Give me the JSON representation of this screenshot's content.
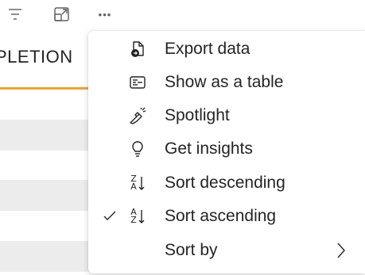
{
  "background": {
    "column_header": "PLETION",
    "accent_color": "#f2a22a"
  },
  "toolbar": {
    "filter_icon": "filter-icon",
    "focus_mode_icon": "focus-mode-icon",
    "more_options_label": "•••"
  },
  "menu": {
    "items": [
      {
        "label": "Export data",
        "icon": "export-data-icon",
        "checked": false
      },
      {
        "label": "Show as a table",
        "icon": "table-icon",
        "checked": false
      },
      {
        "label": "Spotlight",
        "icon": "spotlight-icon",
        "checked": false
      },
      {
        "label": "Get insights",
        "icon": "lightbulb-icon",
        "checked": false
      },
      {
        "label": "Sort descending",
        "icon": "sort-descending-icon",
        "checked": false
      },
      {
        "label": "Sort ascending",
        "icon": "sort-ascending-icon",
        "checked": true
      },
      {
        "label": "Sort by",
        "icon": "",
        "checked": false,
        "has_submenu": true
      }
    ],
    "sort_desc_glyph": {
      "top": "Z",
      "bottom": "A"
    },
    "sort_asc_glyph": {
      "top": "A",
      "bottom": "Z"
    }
  }
}
